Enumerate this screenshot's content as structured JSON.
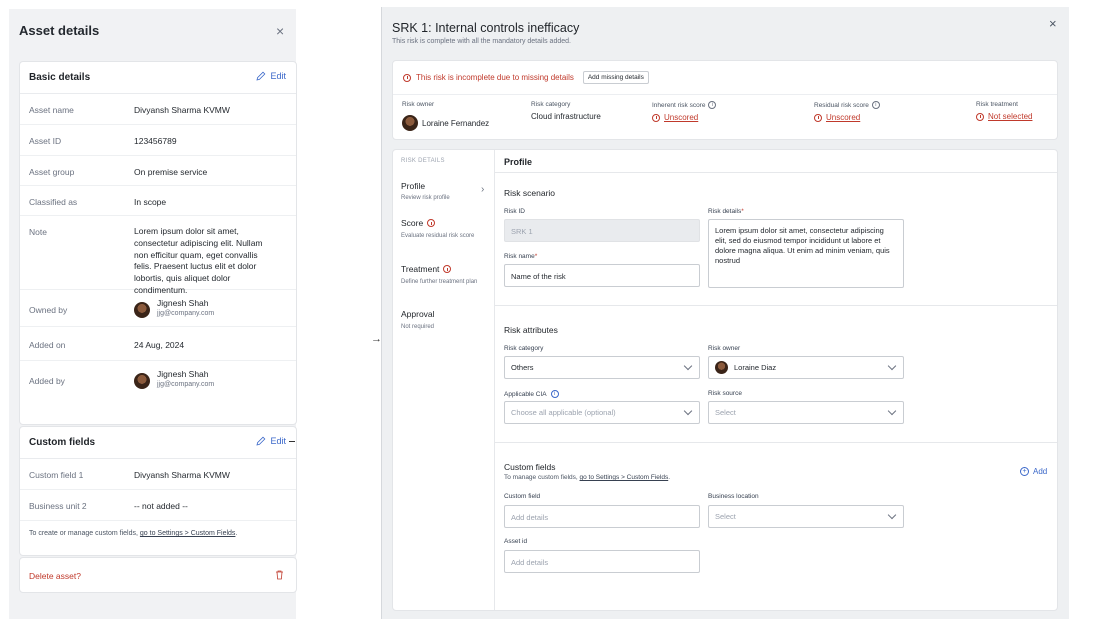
{
  "left_panel": {
    "title": "Asset details",
    "close_label": "×",
    "basic": {
      "title": "Basic details",
      "edit_label": "Edit",
      "rows": [
        {
          "key": "Asset name",
          "value": "Divyansh Sharma KVMW"
        },
        {
          "key": "Asset ID",
          "value": "123456789"
        },
        {
          "key": "Asset group",
          "value": "On premise service"
        },
        {
          "key": "Classified as",
          "value": "In scope"
        },
        {
          "key": "Note",
          "value": "Lorem ipsum dolor sit amet, consectetur adipiscing elit. Nullam non efficitur quam, eget convallis felis. Praesent luctus elit et dolor lobortis, quis aliquet dolor condimentum."
        },
        {
          "key": "Owned by",
          "name": "Jignesh Shah",
          "email": "jjg@company.com"
        },
        {
          "key": "Added on",
          "value": "24 Aug, 2024"
        },
        {
          "key": "Added by",
          "name": "Jignesh Shah",
          "email": "jjg@company.com"
        }
      ]
    },
    "custom": {
      "title": "Custom fields",
      "edit_label": "Edit",
      "rows": [
        {
          "key": "Custom field 1",
          "value": "Divyansh Sharma KVMW"
        },
        {
          "key": "Business unit 2",
          "value": "-- not added --"
        }
      ],
      "note_prefix": "To create or manage custom fields,",
      "note_link": "go to Settings > Custom Fields",
      "note_suffix": "."
    },
    "delete_label": "Delete asset?"
  },
  "modal": {
    "title": "SRK 1: Internal controls inefficacy",
    "subtitle": "This risk is complete with all the mandatory details added.",
    "close_label": "×",
    "warning": {
      "text": "This risk is incomplete due to missing details",
      "button": "Add missing details"
    },
    "summary": {
      "owner_label": "Risk owner",
      "owner_value": "Loraine Fernandez",
      "category_label": "Risk category",
      "category_value": "Cloud infrastructure",
      "inherent_label": "Inherent risk score",
      "inherent_value": "Unscored",
      "residual_label": "Residual risk score",
      "residual_value": "Unscored",
      "treatment_label": "Risk treatment",
      "treatment_value": "Not selected"
    },
    "sidebar": {
      "heading": "RISK DETAILS",
      "steps": [
        {
          "title": "Profile",
          "desc": "Review risk profile"
        },
        {
          "title": "Score",
          "desc": "Evaluate residual risk score"
        },
        {
          "title": "Treatment",
          "desc": "Define further treatment plan"
        },
        {
          "title": "Approval",
          "desc": "Not required"
        }
      ]
    },
    "profile": {
      "heading": "Profile",
      "scenario_title": "Risk scenario",
      "risk_id_label": "Risk ID",
      "risk_id_value": "SRK 1",
      "risk_details_label": "Risk details",
      "risk_details_value": "Lorem ipsum dolor sit amet, consectetur adipiscing elit, sed do eiusmod tempor incididunt ut labore et dolore magna aliqua. Ut enim ad minim veniam, quis nostrud",
      "risk_name_label": "Risk name",
      "risk_name_value": "Name of the risk",
      "attributes_title": "Risk attributes",
      "category_label": "Risk category",
      "category_value": "Others",
      "owner_label": "Risk owner",
      "owner_value": "Loraine Diaz",
      "cia_label": "Applicable CIA",
      "cia_placeholder": "Choose all applicable (optional)",
      "source_label": "Risk source",
      "source_placeholder": "Select",
      "custom_title": "Custom fields",
      "custom_note_prefix": "To manage custom fields,",
      "custom_note_link": "go to Settings > Custom Fields",
      "custom_note_suffix": ".",
      "add_label": "Add",
      "custom_field_label": "Custom field",
      "custom_field_placeholder": "Add details",
      "business_location_label": "Business location",
      "business_location_placeholder": "Select",
      "asset_id_label": "Asset id",
      "asset_id_placeholder": "Add details"
    }
  },
  "colors": {
    "accent": "#3a67c9",
    "danger": "#c0392b"
  }
}
